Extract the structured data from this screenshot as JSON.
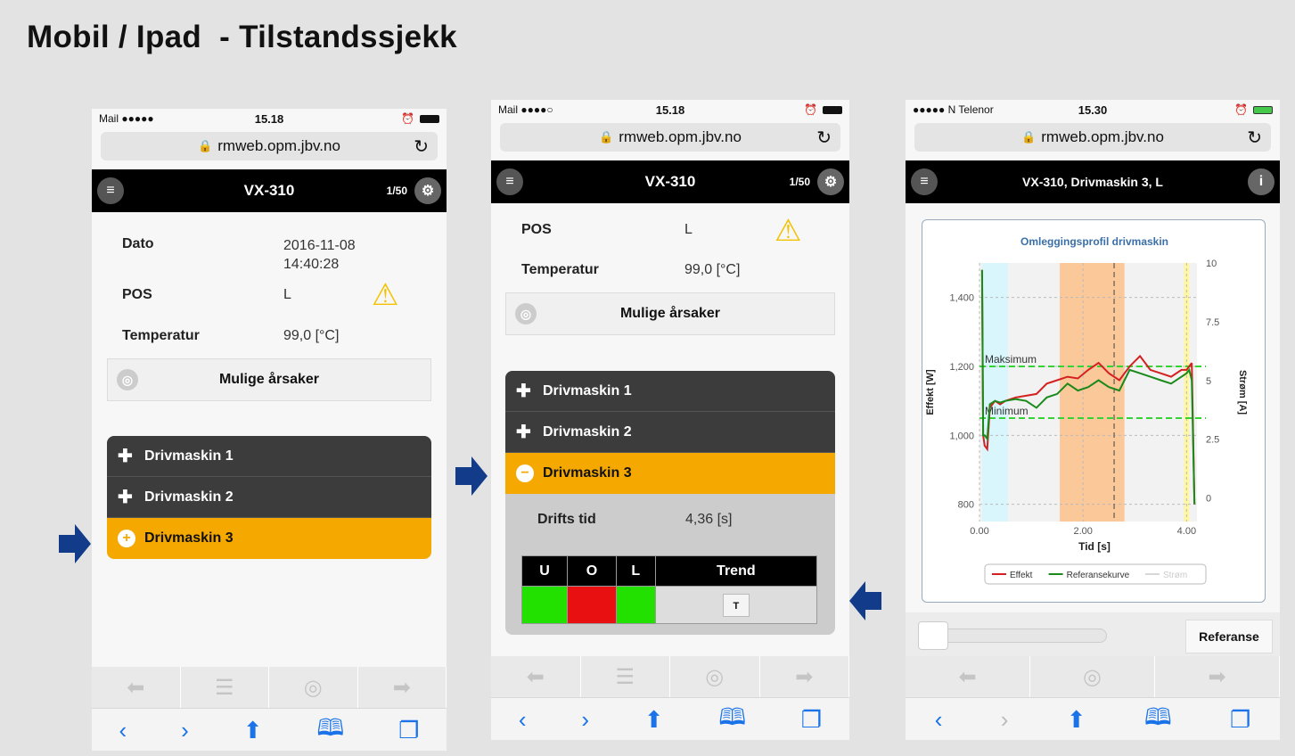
{
  "page_title": "Mobil / Ipad  - Tilstandssjekk",
  "screens": [
    {
      "status_left": "Mail ●●●●●",
      "time": "15.18",
      "url": "rmweb.opm.jbv.no",
      "app_title": "VX-310",
      "counter": "1/50",
      "fields": [
        {
          "label": "Dato",
          "value": "2016-11-08\n14:40:28"
        },
        {
          "label": "POS",
          "value": "L"
        },
        {
          "label": "Temperatur",
          "value": "99,0 [°C]"
        }
      ],
      "mulige": "Mulige årsaker",
      "accordion": [
        "Drivmaskin 1",
        "Drivmaskin 2",
        "Drivmaskin 3"
      ]
    },
    {
      "status_left": "Mail ●●●●○",
      "time": "15.18",
      "url": "rmweb.opm.jbv.no",
      "app_title": "VX-310",
      "counter": "1/50",
      "fields": [
        {
          "label": "POS",
          "value": "L"
        },
        {
          "label": "Temperatur",
          "value": "99,0 [°C]"
        }
      ],
      "mulige": "Mulige årsaker",
      "accordion": [
        "Drivmaskin 1",
        "Drivmaskin 2",
        "Drivmaskin 3"
      ],
      "drifts_label": "Drifts tid",
      "drifts_value": "4,36 [s]",
      "table_headers": [
        "U",
        "O",
        "L",
        "Trend"
      ],
      "table_cells": [
        {
          "status": "ok",
          "color": "#22e000"
        },
        {
          "status": "alarm",
          "color": "#e81010"
        },
        {
          "status": "ok",
          "color": "#22e000"
        }
      ],
      "trend_button": "T"
    },
    {
      "status_left": "●●●●● N Telenor",
      "time": "15.30",
      "url": "rmweb.opm.jbv.no",
      "app_title": "VX-310, Drivmaskin 3, L",
      "referanse": "Referanse"
    }
  ],
  "chart_data": {
    "type": "line",
    "title": "Omleggingsprofil drivmaskin",
    "xlabel": "Tid [s]",
    "ylabel": "Effekt [W]",
    "y2label": "Strøm [A]",
    "xlim": [
      0,
      4.2
    ],
    "ylim": [
      750,
      1500
    ],
    "y2lim": [
      -1,
      10
    ],
    "x_ticks": [
      "0.00",
      "2.00",
      "4.00"
    ],
    "y_ticks": [
      "800",
      "1,000",
      "1,200",
      "1,400"
    ],
    "y2_ticks": [
      "0",
      "2.5",
      "5",
      "7.5",
      "10"
    ],
    "thresholds": [
      {
        "name": "Maksimum",
        "value": 1200
      },
      {
        "name": "Minimum",
        "value": 1050
      }
    ],
    "series": [
      {
        "name": "Effekt",
        "color": "#d42020",
        "x": [
          0.05,
          0.07,
          0.1,
          0.15,
          0.2,
          0.3,
          0.4,
          0.5,
          0.7,
          0.9,
          1.1,
          1.3,
          1.5,
          1.7,
          1.9,
          2.1,
          2.3,
          2.5,
          2.7,
          2.9,
          3.1,
          3.3,
          3.5,
          3.7,
          3.9,
          4.0,
          4.05,
          4.1
        ],
        "y": [
          1480,
          1000,
          970,
          960,
          1080,
          1100,
          1090,
          1100,
          1110,
          1115,
          1120,
          1150,
          1160,
          1170,
          1165,
          1190,
          1210,
          1180,
          1160,
          1200,
          1230,
          1190,
          1180,
          1170,
          1190,
          1190,
          1200,
          1210
        ]
      },
      {
        "name": "Referansekurve",
        "color": "#1a8a1a",
        "x": [
          0.05,
          0.07,
          0.1,
          0.15,
          0.2,
          0.3,
          0.4,
          0.5,
          0.7,
          0.9,
          1.1,
          1.3,
          1.5,
          1.7,
          1.9,
          2.1,
          2.3,
          2.5,
          2.7,
          2.9,
          3.1,
          3.3,
          3.5,
          3.7,
          3.9,
          4.0,
          4.05,
          4.1
        ],
        "y": [
          1480,
          1000,
          1000,
          990,
          1090,
          1100,
          1095,
          1100,
          1105,
          1100,
          1080,
          1110,
          1120,
          1150,
          1130,
          1140,
          1160,
          1140,
          1130,
          1190,
          1180,
          1170,
          1160,
          1150,
          1170,
          1180,
          1190,
          1160
        ]
      },
      {
        "name": "Strøm",
        "color": "#d8d8d8"
      }
    ]
  }
}
